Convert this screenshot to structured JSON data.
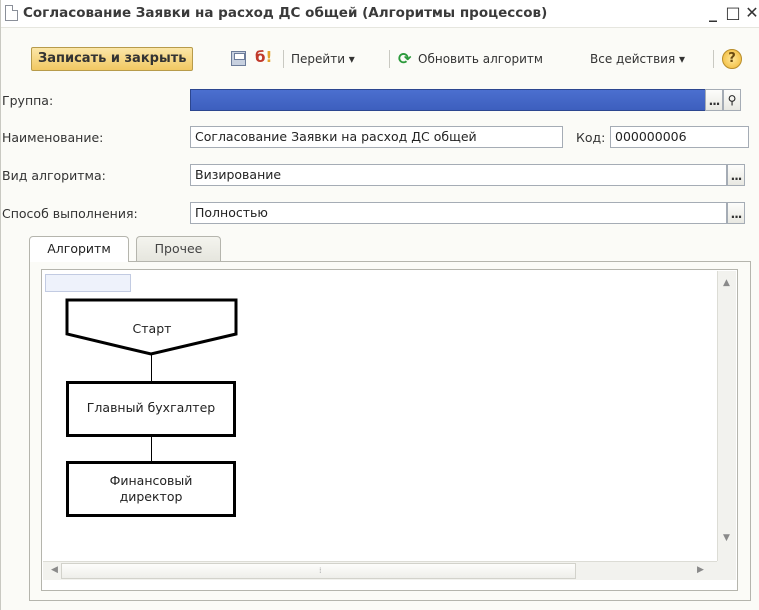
{
  "window": {
    "title": "Согласование Заявки на расход ДС общей (Алгоритмы процессов)",
    "minimize": "_",
    "maximize": "□",
    "close": "✕"
  },
  "toolbar": {
    "save_close_label": "Записать и закрыть",
    "goto_label": "Перейти ▾",
    "refresh_label": "Обновить алгоритм",
    "all_actions_label": "Все действия ▾",
    "help_symbol": "?"
  },
  "form": {
    "group_label": "Группа:",
    "group_value": "",
    "name_label": "Наименование:",
    "name_value": "Согласование Заявки на расход ДС общей",
    "code_label": "Код:",
    "code_value": "000000006",
    "type_label": "Вид алгоритма:",
    "type_value": "Визирование",
    "method_label": "Способ выполнения:",
    "method_value": "Полностью",
    "dots": "...",
    "search_symbol": "🔍"
  },
  "tabs": [
    {
      "label": "Алгоритм",
      "active": true
    },
    {
      "label": "Прочее",
      "active": false
    }
  ],
  "diagram": {
    "nodes": [
      {
        "label": "Старт",
        "shape": "pentagon-down"
      },
      {
        "label": "Главный бухгалтер",
        "shape": "rect"
      },
      {
        "label_line1": "Финансовый",
        "label_line2": "директор",
        "shape": "rect"
      }
    ]
  },
  "colors": {
    "accent_button": "#f1c862",
    "selection": "#3d5fbe"
  }
}
